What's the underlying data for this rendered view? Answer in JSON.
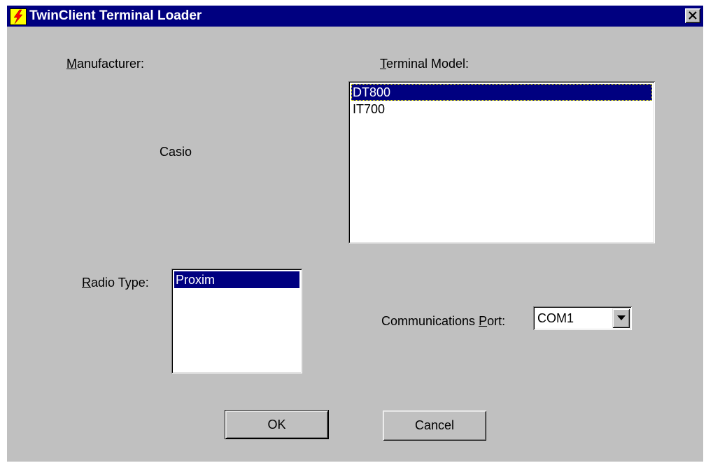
{
  "window": {
    "title": "TwinClient Terminal Loader",
    "icon": "lightning-bolt-icon",
    "close_icon": "close-icon"
  },
  "manufacturer": {
    "label_accel": "M",
    "label_rest": "anufacturer:",
    "value": "Casio"
  },
  "terminal_model": {
    "label_accel": "T",
    "label_rest": "erminal Model:",
    "items": [
      {
        "label": "DT800",
        "selected": true
      },
      {
        "label": "IT700",
        "selected": false
      }
    ]
  },
  "radio_type": {
    "label_accel": "R",
    "label_rest": "adio Type:",
    "items": [
      {
        "label": "Proxim",
        "selected": true
      }
    ]
  },
  "communications_port": {
    "label_prefix": "Communications ",
    "label_accel": "P",
    "label_rest": "ort:",
    "value": "COM1",
    "dropdown_icon": "triangle-down-icon"
  },
  "buttons": {
    "ok": "OK",
    "cancel": "Cancel"
  },
  "colors": {
    "title_bar": "#000080",
    "dialog_face": "#c0c0c0",
    "selection": "#000080",
    "icon_background": "#ffff00",
    "icon_bolt": "#ff0000"
  }
}
